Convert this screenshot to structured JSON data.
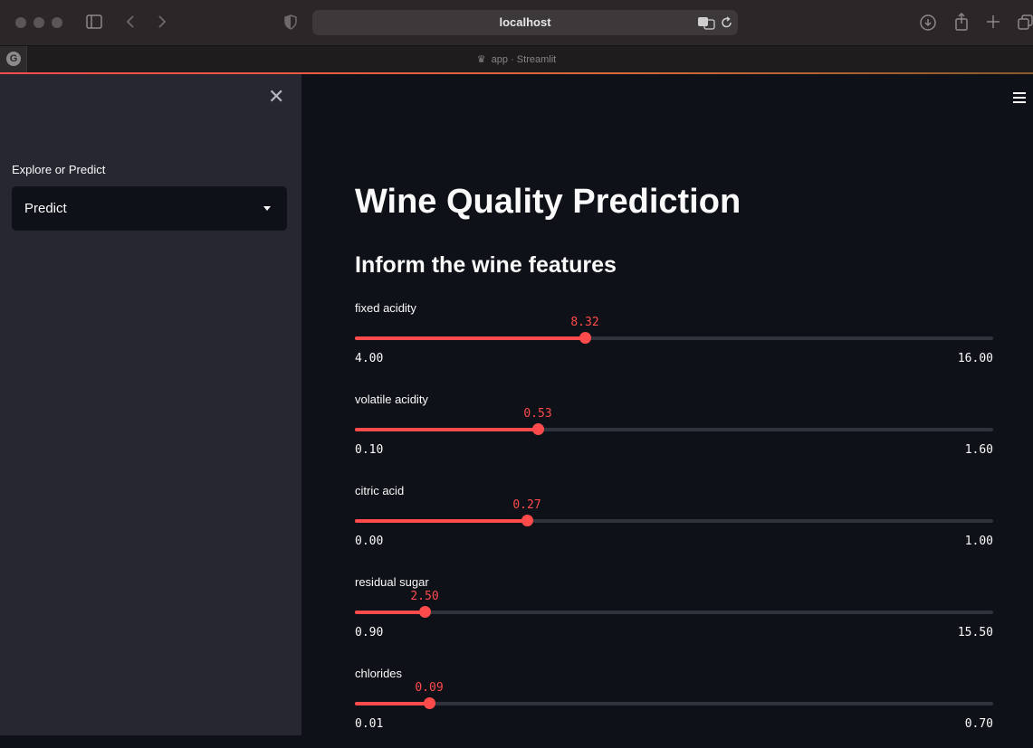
{
  "browser": {
    "url": "localhost",
    "tab_title": "app · Streamlit"
  },
  "sidebar": {
    "select_label": "Explore or Predict",
    "select_value": "Predict"
  },
  "main": {
    "title": "Wine Quality Prediction",
    "subtitle": "Inform the wine features",
    "sliders": [
      {
        "label": "fixed acidity",
        "value": "8.32",
        "min": "4.00",
        "max": "16.00",
        "v": 8.32,
        "lo": 4.0,
        "hi": 16.0
      },
      {
        "label": "volatile acidity",
        "value": "0.53",
        "min": "0.10",
        "max": "1.60",
        "v": 0.53,
        "lo": 0.1,
        "hi": 1.6
      },
      {
        "label": "citric acid",
        "value": "0.27",
        "min": "0.00",
        "max": "1.00",
        "v": 0.27,
        "lo": 0.0,
        "hi": 1.0
      },
      {
        "label": "residual sugar",
        "value": "2.50",
        "min": "0.90",
        "max": "15.50",
        "v": 2.5,
        "lo": 0.9,
        "hi": 15.5
      },
      {
        "label": "chlorides",
        "value": "0.09",
        "min": "0.01",
        "max": "0.70",
        "v": 0.09,
        "lo": 0.01,
        "hi": 0.7
      }
    ]
  },
  "colors": {
    "accent": "#ff4b4b",
    "background": "#0e1117",
    "sidebar": "#262730"
  }
}
